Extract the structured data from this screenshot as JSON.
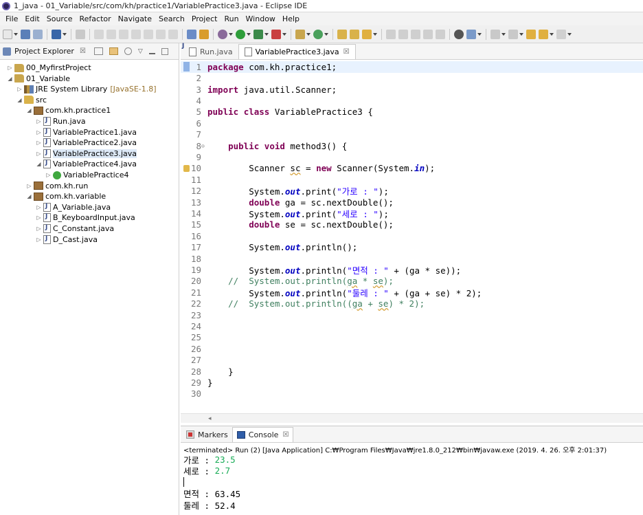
{
  "window": {
    "title": "1_java - 01_Variable/src/com/kh/practice1/VariablePractice3.java - Eclipse IDE"
  },
  "menubar": [
    "File",
    "Edit",
    "Source",
    "Refactor",
    "Navigate",
    "Search",
    "Project",
    "Run",
    "Window",
    "Help"
  ],
  "project_explorer": {
    "tab_label": "Project Explorer",
    "close_symbol": "☒",
    "tree": [
      {
        "label": "00_MyfirstProject",
        "icon": "project-icon",
        "twisty": "▷",
        "indent": 0
      },
      {
        "label": "01_Variable",
        "icon": "project-icon",
        "twisty": "◢",
        "indent": 0
      },
      {
        "label": "JRE System Library",
        "decor": "[JavaSE-1.8]",
        "icon": "library-icon",
        "twisty": "▷",
        "indent": 1
      },
      {
        "label": "src",
        "icon": "source-folder-icon",
        "twisty": "◢",
        "indent": 1
      },
      {
        "label": "com.kh.practice1",
        "icon": "package-icon",
        "twisty": "◢",
        "indent": 2
      },
      {
        "label": "Run.java",
        "icon": "java-file-icon",
        "twisty": "▷",
        "indent": 3
      },
      {
        "label": "VariablePractice1.java",
        "icon": "java-file-icon",
        "twisty": "▷",
        "indent": 3
      },
      {
        "label": "VariablePractice2.java",
        "icon": "java-file-icon",
        "twisty": "▷",
        "indent": 3
      },
      {
        "label": "VariablePractice3.java",
        "icon": "java-file-icon",
        "twisty": "▷",
        "indent": 3,
        "selected": true
      },
      {
        "label": "VariablePractice4.java",
        "icon": "java-file-icon",
        "twisty": "◢",
        "indent": 3
      },
      {
        "label": "VariablePractice4",
        "icon": "class-icon",
        "twisty": "▷",
        "indent": 4
      },
      {
        "label": "com.kh.run",
        "icon": "package-icon",
        "twisty": "▷",
        "indent": 2
      },
      {
        "label": "com.kh.variable",
        "icon": "package-icon",
        "twisty": "◢",
        "indent": 2
      },
      {
        "label": "A_Variable.java",
        "icon": "java-file-icon",
        "twisty": "▷",
        "indent": 3
      },
      {
        "label": "B_KeyboardInput.java",
        "icon": "java-file-icon",
        "twisty": "▷",
        "indent": 3
      },
      {
        "label": "C_Constant.java",
        "icon": "java-file-icon",
        "twisty": "▷",
        "indent": 3
      },
      {
        "label": "D_Cast.java",
        "icon": "java-file-icon",
        "twisty": "▷",
        "indent": 3
      }
    ]
  },
  "editor": {
    "tabs": [
      {
        "label": "Run.java",
        "active": false
      },
      {
        "label": "VariablePractice3.java",
        "active": true,
        "close": "☒"
      }
    ],
    "lines": [
      {
        "n": "1",
        "html": "<span class='kw'>package</span> com.kh.practice1;"
      },
      {
        "n": "2",
        "html": ""
      },
      {
        "n": "3",
        "html": "<span class='kw'>import</span> java.util.Scanner;"
      },
      {
        "n": "4",
        "html": ""
      },
      {
        "n": "5",
        "html": "<span class='kw'>public</span> <span class='kw'>class</span> VariablePractice3 {"
      },
      {
        "n": "6",
        "html": ""
      },
      {
        "n": "7",
        "html": ""
      },
      {
        "n": "8",
        "fold": "⊖",
        "html": "    <span class='kw'>public</span> <span class='kw'>void</span> method3() {"
      },
      {
        "n": "9",
        "html": ""
      },
      {
        "n": "10",
        "warn": true,
        "html": "        Scanner <span class='squig'>sc</span> = <span class='kw'>new</span> Scanner(System.<span class='fld'>in</span>);"
      },
      {
        "n": "11",
        "html": ""
      },
      {
        "n": "12",
        "html": "        System.<span class='fld'>out</span>.print(<span class='str'>\"가로 : \"</span>);"
      },
      {
        "n": "13",
        "html": "        <span class='kw'>double</span> ga = sc.nextDouble();"
      },
      {
        "n": "14",
        "html": "        System.<span class='fld'>out</span>.print(<span class='str'>\"세로 : \"</span>);"
      },
      {
        "n": "15",
        "html": "        <span class='kw'>double</span> se = sc.nextDouble();"
      },
      {
        "n": "16",
        "html": ""
      },
      {
        "n": "17",
        "html": "        System.<span class='fld'>out</span>.println();"
      },
      {
        "n": "18",
        "html": ""
      },
      {
        "n": "19",
        "html": "        System.<span class='fld'>out</span>.println(<span class='str'>\"면적 : \"</span> + (ga * se));"
      },
      {
        "n": "20",
        "html": "    <span class='cmt'>//  System.out.println(<span class='squig'>ga</span> * <span class='squig'>se</span>);</span>"
      },
      {
        "n": "21",
        "html": "        System.<span class='fld'>out</span>.println(<span class='str'>\"둘레 : \"</span> + (ga + se) * 2);"
      },
      {
        "n": "22",
        "html": "    <span class='cmt'>//  System.out.println((<span class='squig'>ga</span> + <span class='squig'>se</span>) * 2);</span>"
      },
      {
        "n": "23",
        "html": ""
      },
      {
        "n": "24",
        "html": ""
      },
      {
        "n": "25",
        "html": ""
      },
      {
        "n": "26",
        "html": ""
      },
      {
        "n": "27",
        "html": ""
      },
      {
        "n": "28",
        "html": "    }"
      },
      {
        "n": "29",
        "html": "}"
      },
      {
        "n": "30",
        "html": ""
      }
    ]
  },
  "console": {
    "tabs": [
      {
        "label": "Markers",
        "active": false
      },
      {
        "label": "Console",
        "active": true,
        "close": "☒"
      }
    ],
    "status": "<terminated> Run (2) [Java Application] C:₩Program Files₩Java₩jre1.8.0_212₩bin₩javaw.exe (2019. 4. 26. 오후 2:01:37)",
    "output": [
      {
        "prompt": "가로 : ",
        "input": "23.5"
      },
      {
        "prompt": "세로 : ",
        "input": "2.7"
      },
      {
        "prompt": "",
        "input": ""
      },
      {
        "prompt": "면적 : 63.45",
        "input": ""
      },
      {
        "prompt": "둘레 : 52.4",
        "input": ""
      }
    ]
  }
}
